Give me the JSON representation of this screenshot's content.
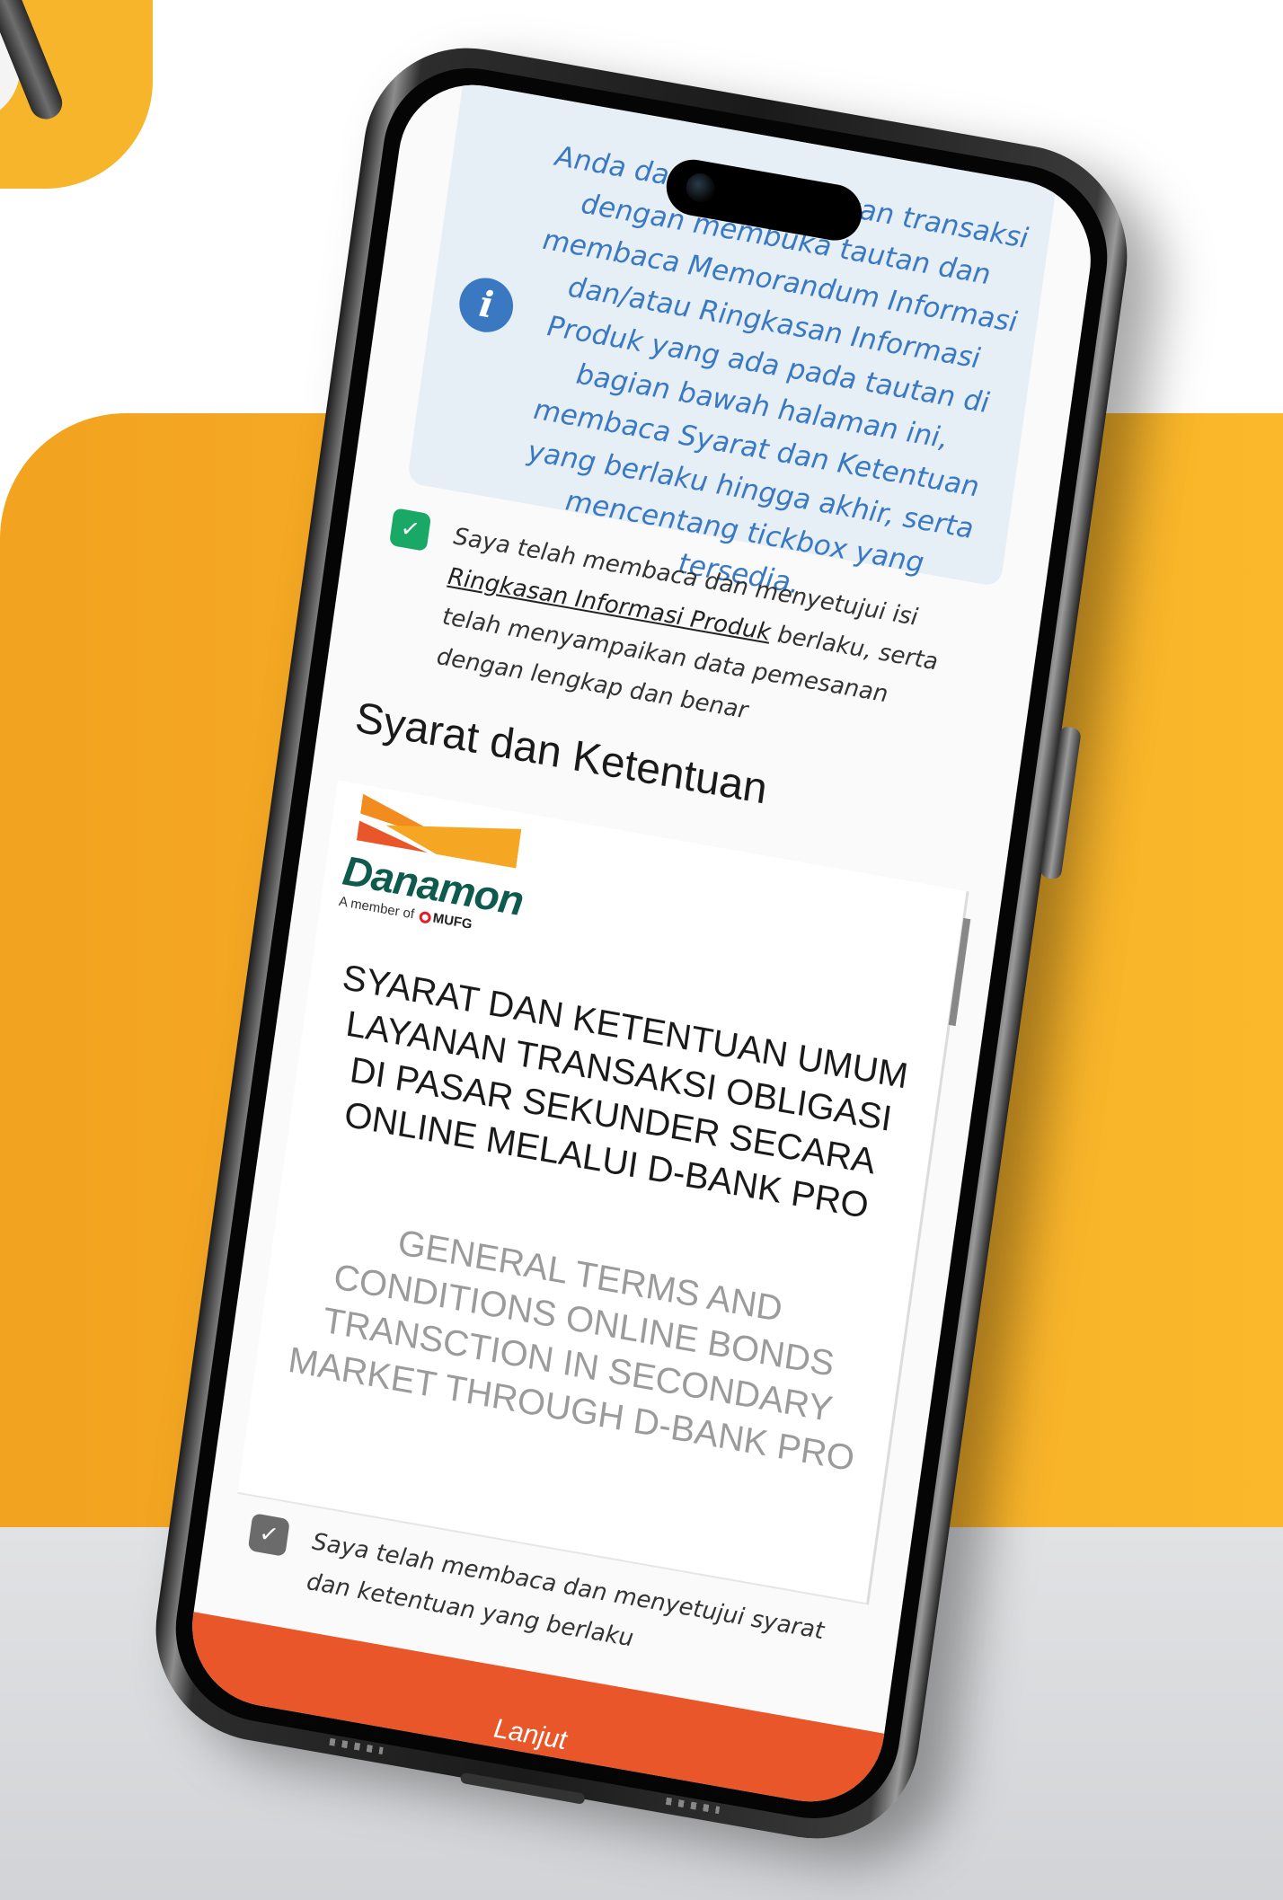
{
  "info": {
    "icon": "info-icon",
    "lines": [
      "Anda dapat melanjutkan transaksi",
      "dengan membuka tautan dan",
      "membaca Memorandum Informasi",
      "dan/atau Ringkasan Informasi",
      "Produk yang ada pada tautan di",
      "bagian bawah halaman ini,",
      "membaca Syarat dan Ketentuan",
      "yang berlaku hingga akhir, serta",
      "mencentang tickbox yang tersedia."
    ]
  },
  "consent_product": {
    "checked": true,
    "text_before": "Saya telah membaca dan menyetujui isi",
    "link": "Ringkasan Informasi Produk",
    "text_after": "berlaku, serta telah menyampaikan data pemesanan dengan lengkap dan benar"
  },
  "terms_section": {
    "title": "Syarat dan Ketentuan",
    "logo_brand": "Danamon",
    "logo_member_prefix": "A member of",
    "logo_member_group": "MUFG",
    "doc_title_id": "SYARAT DAN KETENTUAN UMUM LAYANAN TRANSAKSI OBLIGASI DI PASAR SEKUNDER SECARA ONLINE MELALUI D-BANK PRO",
    "doc_title_en": "GENERAL TERMS AND CONDITIONS ONLINE BONDS TRANSCTION IN SECONDARY MARKET THROUGH D-BANK PRO"
  },
  "consent_terms": {
    "checked": true,
    "text": "Saya telah membaca dan menyetujui syarat dan ketentuan yang berlaku"
  },
  "next_button": {
    "label": "Lanjut"
  },
  "colors": {
    "accent_button": "#e8562a",
    "info_text": "#3a79c2",
    "check_green": "#1aa866",
    "check_gray": "#6b6b6b",
    "brand_green": "#0e5a4c",
    "background_orange": "#f8b02a"
  }
}
